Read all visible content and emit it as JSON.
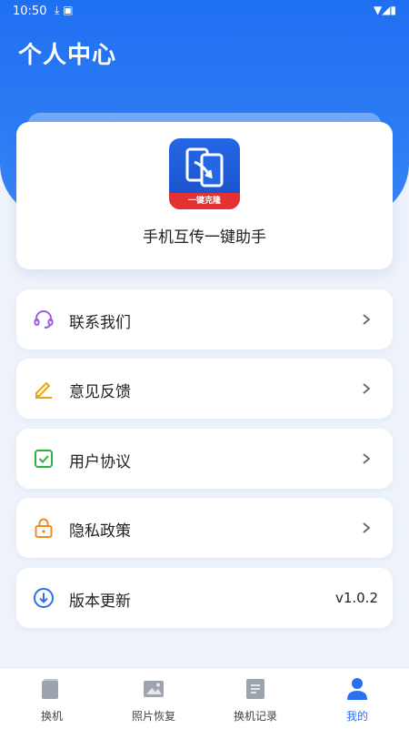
{
  "status_bar": {
    "time": "10:50"
  },
  "header": {
    "title": "个人中心"
  },
  "app_card": {
    "logo_banner": "一键克隆",
    "app_name": "手机互传一键助手"
  },
  "menu": {
    "contact": {
      "label": "联系我们",
      "icon": "headset-icon"
    },
    "feedback": {
      "label": "意见反馈",
      "icon": "pencil-icon"
    },
    "agreement": {
      "label": "用户协议",
      "icon": "checkbox-icon"
    },
    "privacy": {
      "label": "隐私政策",
      "icon": "lock-icon"
    },
    "version": {
      "label": "版本更新",
      "value": "v1.0.2",
      "icon": "download-icon"
    }
  },
  "tabs": [
    {
      "label": "换机",
      "icon": "phone-icon"
    },
    {
      "label": "照片恢复",
      "icon": "photo-icon"
    },
    {
      "label": "换机记录",
      "icon": "record-icon"
    },
    {
      "label": "我的",
      "icon": "user-icon",
      "active": true
    }
  ],
  "colors": {
    "primary": "#2a6ff0",
    "header": "#1f6ff2",
    "contact_icon": "#9b5de5",
    "feedback_icon": "#e8a317",
    "agreement_icon": "#2fb344",
    "privacy_icon": "#f08a24",
    "version_icon": "#2a6ff0"
  }
}
